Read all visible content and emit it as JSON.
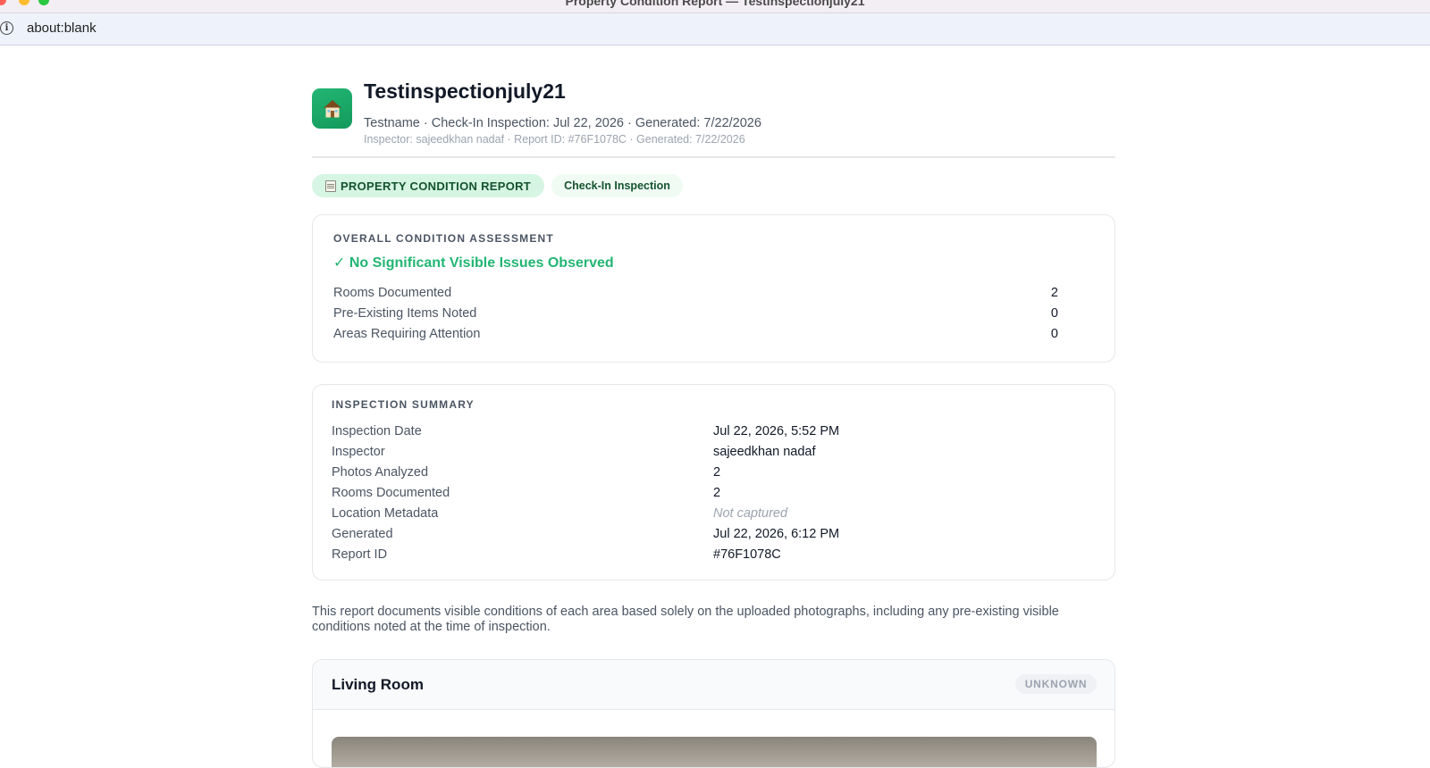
{
  "window": {
    "title": "Property Condition Report — Testinspectionjuly21"
  },
  "browser": {
    "url": "about:blank"
  },
  "report": {
    "title": "Testinspectionjuly21",
    "subtitle": "Testname · Check-In Inspection: Jul 22, 2026 · Generated: 7/22/2026",
    "meta": "Inspector: sajeedkhan nadaf · Report ID: #76F1078C · Generated: 7/22/2026",
    "badge_primary": "PROPERTY CONDITION REPORT",
    "badge_secondary": "Check-In Inspection"
  },
  "assessment": {
    "heading": "OVERALL CONDITION ASSESSMENT",
    "status": "✓ No Significant Visible Issues Observed",
    "status_color": "#22b573",
    "stats": [
      {
        "label": "Rooms Documented",
        "value": "2"
      },
      {
        "label": "Pre-Existing Items Noted",
        "value": "0"
      },
      {
        "label": "Areas Requiring Attention",
        "value": "0"
      }
    ]
  },
  "summary": {
    "heading": "INSPECTION SUMMARY",
    "rows": [
      {
        "label": "Inspection Date",
        "value": "Jul 22, 2026, 5:52 PM"
      },
      {
        "label": "Inspector",
        "value": "sajeedkhan nadaf"
      },
      {
        "label": "Photos Analyzed",
        "value": "2"
      },
      {
        "label": "Rooms Documented",
        "value": "2"
      },
      {
        "label": "Location Metadata",
        "value": "Not captured"
      },
      {
        "label": "Generated",
        "value": "Jul 22, 2026, 6:12 PM"
      },
      {
        "label": "Report ID",
        "value": "#76F1078C"
      }
    ]
  },
  "disclaimer": "This report documents visible conditions of each area based solely on the uploaded photographs, including any pre-existing visible conditions noted at the time of inspection.",
  "rooms": [
    {
      "name": "Living Room",
      "status": "UNKNOWN"
    }
  ],
  "icons": {
    "app_logo": "house-icon",
    "badge": "notepad-icon",
    "address": "info-icon"
  },
  "colors": {
    "accent": "#22b573",
    "badge_bg": "#d6f5e3"
  }
}
